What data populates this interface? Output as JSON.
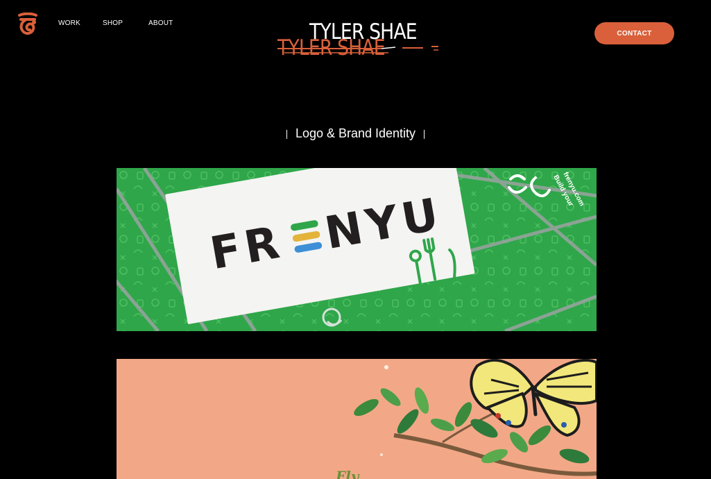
{
  "header": {
    "logo_icon": "tyler-shae-monogram-icon",
    "nav": [
      {
        "label": "WORK"
      },
      {
        "label": "SHOP"
      },
      {
        "label": "ABOUT"
      }
    ],
    "brand_name": "TYLER SHAE",
    "contact_label": "CONTACT"
  },
  "section": {
    "title": "Logo & Brand Identity"
  },
  "projects": [
    {
      "brand_text": "FRENYU",
      "card_side_text": "Build your frenyu.com"
    },
    {
      "brand_text": "Fly"
    }
  ],
  "colors": {
    "background": "#000000",
    "accent": "#d9603a",
    "frenyu_green": "#2fa64a",
    "peach": "#f2a887"
  }
}
